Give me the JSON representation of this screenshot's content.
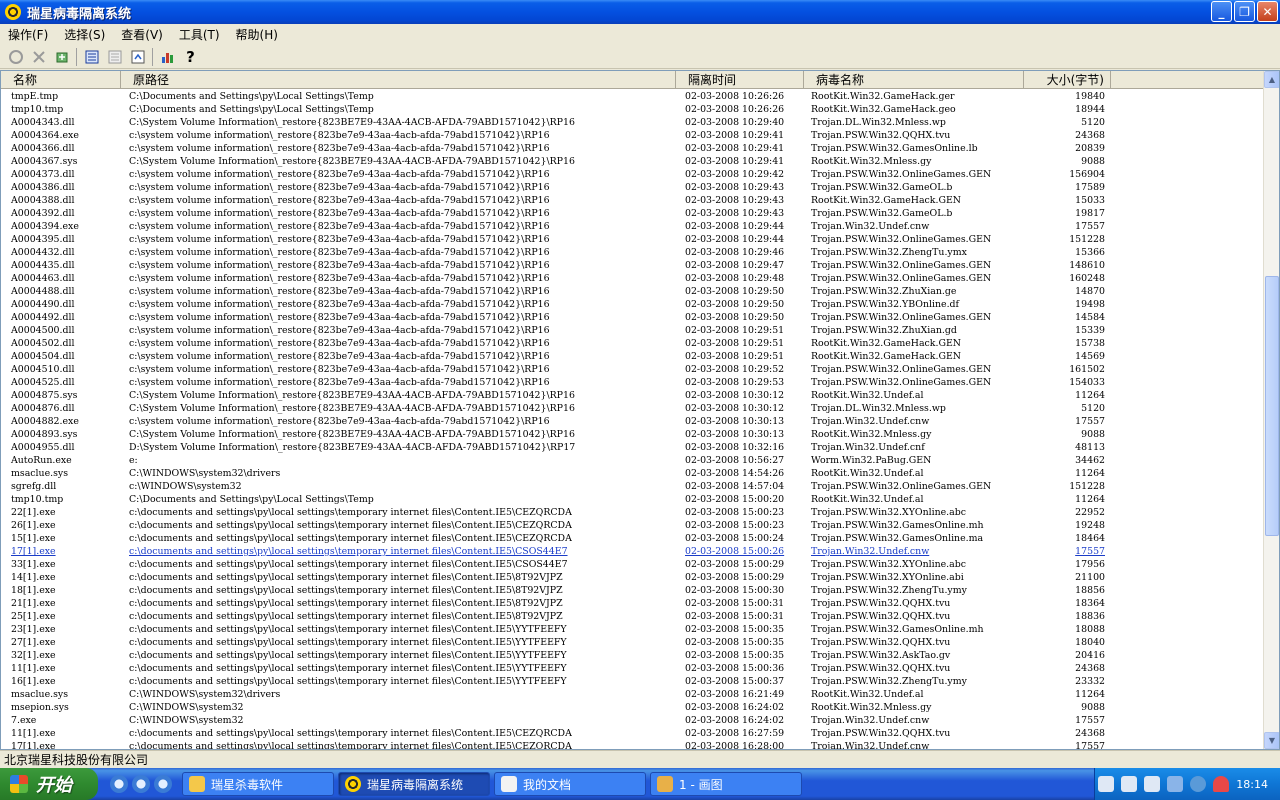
{
  "window": {
    "title": "瑞星病毒隔离系统",
    "buttons": [
      "_",
      "❐",
      "✕"
    ]
  },
  "menu": [
    "操作(F)",
    "选择(S)",
    "查看(V)",
    "工具(T)",
    "帮助(H)"
  ],
  "columns": [
    "名称",
    "原路径",
    "隔离时间",
    "病毒名称",
    "大小(字节)"
  ],
  "rows": [
    [
      "tmpE.tmp",
      "C:\\Documents and Settings\\py\\Local Settings\\Temp",
      "02-03-2008 10:26:26",
      "RootKit.Win32.GameHack.ger",
      "19840"
    ],
    [
      "tmp10.tmp",
      "C:\\Documents and Settings\\py\\Local Settings\\Temp",
      "02-03-2008 10:26:26",
      "RootKit.Win32.GameHack.geo",
      "18944"
    ],
    [
      "A0004343.dll",
      "C:\\System Volume Information\\_restore{823BE7E9-43AA-4ACB-AFDA-79ABD1571042}\\RP16",
      "02-03-2008 10:29:40",
      "Trojan.DL.Win32.Mnless.wp",
      "5120"
    ],
    [
      "A0004364.exe",
      "c:\\system volume information\\_restore{823be7e9-43aa-4acb-afda-79abd1571042}\\RP16",
      "02-03-2008 10:29:41",
      "Trojan.PSW.Win32.QQHX.tvu",
      "24368"
    ],
    [
      "A0004366.dll",
      "c:\\system volume information\\_restore{823be7e9-43aa-4acb-afda-79abd1571042}\\RP16",
      "02-03-2008 10:29:41",
      "Trojan.PSW.Win32.GamesOnline.lb",
      "20839"
    ],
    [
      "A0004367.sys",
      "C:\\System Volume Information\\_restore{823BE7E9-43AA-4ACB-AFDA-79ABD1571042}\\RP16",
      "02-03-2008 10:29:41",
      "RootKit.Win32.Mnless.gy",
      "9088"
    ],
    [
      "A0004373.dll",
      "c:\\system volume information\\_restore{823be7e9-43aa-4acb-afda-79abd1571042}\\RP16",
      "02-03-2008 10:29:42",
      "Trojan.PSW.Win32.OnlineGames.GEN",
      "156904"
    ],
    [
      "A0004386.dll",
      "c:\\system volume information\\_restore{823be7e9-43aa-4acb-afda-79abd1571042}\\RP16",
      "02-03-2008 10:29:43",
      "Trojan.PSW.Win32.GameOL.b",
      "17589"
    ],
    [
      "A0004388.dll",
      "c:\\system volume information\\_restore{823be7e9-43aa-4acb-afda-79abd1571042}\\RP16",
      "02-03-2008 10:29:43",
      "RootKit.Win32.GameHack.GEN",
      "15033"
    ],
    [
      "A0004392.dll",
      "c:\\system volume information\\_restore{823be7e9-43aa-4acb-afda-79abd1571042}\\RP16",
      "02-03-2008 10:29:43",
      "Trojan.PSW.Win32.GameOL.b",
      "19817"
    ],
    [
      "A0004394.exe",
      "c:\\system volume information\\_restore{823be7e9-43aa-4acb-afda-79abd1571042}\\RP16",
      "02-03-2008 10:29:44",
      "Trojan.Win32.Undef.cnw",
      "17557"
    ],
    [
      "A0004395.dll",
      "c:\\system volume information\\_restore{823be7e9-43aa-4acb-afda-79abd1571042}\\RP16",
      "02-03-2008 10:29:44",
      "Trojan.PSW.Win32.OnlineGames.GEN",
      "151228"
    ],
    [
      "A0004432.dll",
      "c:\\system volume information\\_restore{823be7e9-43aa-4acb-afda-79abd1571042}\\RP16",
      "02-03-2008 10:29:46",
      "Trojan.PSW.Win32.ZhengTu.ymx",
      "15366"
    ],
    [
      "A0004435.dll",
      "c:\\system volume information\\_restore{823be7e9-43aa-4acb-afda-79abd1571042}\\RP16",
      "02-03-2008 10:29:47",
      "Trojan.PSW.Win32.OnlineGames.GEN",
      "148610"
    ],
    [
      "A0004463.dll",
      "c:\\system volume information\\_restore{823be7e9-43aa-4acb-afda-79abd1571042}\\RP16",
      "02-03-2008 10:29:48",
      "Trojan.PSW.Win32.OnlineGames.GEN",
      "160248"
    ],
    [
      "A0004488.dll",
      "c:\\system volume information\\_restore{823be7e9-43aa-4acb-afda-79abd1571042}\\RP16",
      "02-03-2008 10:29:50",
      "Trojan.PSW.Win32.ZhuXian.ge",
      "14870"
    ],
    [
      "A0004490.dll",
      "c:\\system volume information\\_restore{823be7e9-43aa-4acb-afda-79abd1571042}\\RP16",
      "02-03-2008 10:29:50",
      "Trojan.PSW.Win32.YBOnline.df",
      "19498"
    ],
    [
      "A0004492.dll",
      "c:\\system volume information\\_restore{823be7e9-43aa-4acb-afda-79abd1571042}\\RP16",
      "02-03-2008 10:29:50",
      "Trojan.PSW.Win32.OnlineGames.GEN",
      "14584"
    ],
    [
      "A0004500.dll",
      "c:\\system volume information\\_restore{823be7e9-43aa-4acb-afda-79abd1571042}\\RP16",
      "02-03-2008 10:29:51",
      "Trojan.PSW.Win32.ZhuXian.gd",
      "15339"
    ],
    [
      "A0004502.dll",
      "c:\\system volume information\\_restore{823be7e9-43aa-4acb-afda-79abd1571042}\\RP16",
      "02-03-2008 10:29:51",
      "RootKit.Win32.GameHack.GEN",
      "15738"
    ],
    [
      "A0004504.dll",
      "c:\\system volume information\\_restore{823be7e9-43aa-4acb-afda-79abd1571042}\\RP16",
      "02-03-2008 10:29:51",
      "RootKit.Win32.GameHack.GEN",
      "14569"
    ],
    [
      "A0004510.dll",
      "c:\\system volume information\\_restore{823be7e9-43aa-4acb-afda-79abd1571042}\\RP16",
      "02-03-2008 10:29:52",
      "Trojan.PSW.Win32.OnlineGames.GEN",
      "161502"
    ],
    [
      "A0004525.dll",
      "c:\\system volume information\\_restore{823be7e9-43aa-4acb-afda-79abd1571042}\\RP16",
      "02-03-2008 10:29:53",
      "Trojan.PSW.Win32.OnlineGames.GEN",
      "154033"
    ],
    [
      "A0004875.sys",
      "C:\\System Volume Information\\_restore{823BE7E9-43AA-4ACB-AFDA-79ABD1571042}\\RP16",
      "02-03-2008 10:30:12",
      "RootKit.Win32.Undef.al",
      "11264"
    ],
    [
      "A0004876.dll",
      "C:\\System Volume Information\\_restore{823BE7E9-43AA-4ACB-AFDA-79ABD1571042}\\RP16",
      "02-03-2008 10:30:12",
      "Trojan.DL.Win32.Mnless.wp",
      "5120"
    ],
    [
      "A0004882.exe",
      "c:\\system volume information\\_restore{823be7e9-43aa-4acb-afda-79abd1571042}\\RP16",
      "02-03-2008 10:30:13",
      "Trojan.Win32.Undef.cnw",
      "17557"
    ],
    [
      "A0004893.sys",
      "C:\\System Volume Information\\_restore{823BE7E9-43AA-4ACB-AFDA-79ABD1571042}\\RP16",
      "02-03-2008 10:30:13",
      "RootKit.Win32.Mnless.gy",
      "9088"
    ],
    [
      "A0004955.dll",
      "D:\\System Volume Information\\_restore{823BE7E9-43AA-4ACB-AFDA-79ABD1571042}\\RP17",
      "02-03-2008 10:32:16",
      "Trojan.Win32.Undef.cnf",
      "48113"
    ],
    [
      "AutoRun.exe",
      "e:",
      "02-03-2008 10:56:27",
      "Worm.Win32.PaBug.GEN",
      "34462"
    ],
    [
      "msaclue.sys",
      "C:\\WINDOWS\\system32\\drivers",
      "02-03-2008 14:54:26",
      "RootKit.Win32.Undef.al",
      "11264"
    ],
    [
      "sgrefg.dll",
      "c:\\WINDOWS\\system32",
      "02-03-2008 14:57:04",
      "Trojan.PSW.Win32.OnlineGames.GEN",
      "151228"
    ],
    [
      "tmp10.tmp",
      "C:\\Documents and Settings\\py\\Local Settings\\Temp",
      "02-03-2008 15:00:20",
      "RootKit.Win32.Undef.al",
      "11264"
    ],
    [
      "22[1].exe",
      "c:\\documents and settings\\py\\local settings\\temporary internet files\\Content.IE5\\CEZQRCDA",
      "02-03-2008 15:00:23",
      "Trojan.PSW.Win32.XYOnline.abc",
      "22952"
    ],
    [
      "26[1].exe",
      "c:\\documents and settings\\py\\local settings\\temporary internet files\\Content.IE5\\CEZQRCDA",
      "02-03-2008 15:00:23",
      "Trojan.PSW.Win32.GamesOnline.mh",
      "19248"
    ],
    [
      "15[1].exe",
      "c:\\documents and settings\\py\\local settings\\temporary internet files\\Content.IE5\\CEZQRCDA",
      "02-03-2008 15:00:24",
      "Trojan.PSW.Win32.GamesOnline.ma",
      "18464"
    ],
    [
      "17[1].exe",
      "c:\\documents and settings\\py\\local settings\\temporary internet files\\Content.IE5\\CSOS44E7",
      "02-03-2008 15:00:26",
      "Trojan.Win32.Undef.cnw",
      "17557"
    ],
    [
      "33[1].exe",
      "c:\\documents and settings\\py\\local settings\\temporary internet files\\Content.IE5\\CSOS44E7",
      "02-03-2008 15:00:29",
      "Trojan.PSW.Win32.XYOnline.abc",
      "17956"
    ],
    [
      "14[1].exe",
      "c:\\documents and settings\\py\\local settings\\temporary internet files\\Content.IE5\\8T92VJPZ",
      "02-03-2008 15:00:29",
      "Trojan.PSW.Win32.XYOnline.abi",
      "21100"
    ],
    [
      "18[1].exe",
      "c:\\documents and settings\\py\\local settings\\temporary internet files\\Content.IE5\\8T92VJPZ",
      "02-03-2008 15:00:30",
      "Trojan.PSW.Win32.ZhengTu.ymy",
      "18856"
    ],
    [
      "21[1].exe",
      "c:\\documents and settings\\py\\local settings\\temporary internet files\\Content.IE5\\8T92VJPZ",
      "02-03-2008 15:00:31",
      "Trojan.PSW.Win32.QQHX.tvu",
      "18364"
    ],
    [
      "25[1].exe",
      "c:\\documents and settings\\py\\local settings\\temporary internet files\\Content.IE5\\8T92VJPZ",
      "02-03-2008 15:00:31",
      "Trojan.PSW.Win32.QQHX.tvu",
      "18836"
    ],
    [
      "23[1].exe",
      "c:\\documents and settings\\py\\local settings\\temporary internet files\\Content.IE5\\YYTFEEFY",
      "02-03-2008 15:00:35",
      "Trojan.PSW.Win32.GamesOnline.mh",
      "18088"
    ],
    [
      "27[1].exe",
      "c:\\documents and settings\\py\\local settings\\temporary internet files\\Content.IE5\\YYTFEEFY",
      "02-03-2008 15:00:35",
      "Trojan.PSW.Win32.QQHX.tvu",
      "18040"
    ],
    [
      "32[1].exe",
      "c:\\documents and settings\\py\\local settings\\temporary internet files\\Content.IE5\\YYTFEEFY",
      "02-03-2008 15:00:35",
      "Trojan.PSW.Win32.AskTao.gv",
      "20416"
    ],
    [
      "11[1].exe",
      "c:\\documents and settings\\py\\local settings\\temporary internet files\\Content.IE5\\YYTFEEFY",
      "02-03-2008 15:00:36",
      "Trojan.PSW.Win32.QQHX.tvu",
      "24368"
    ],
    [
      "16[1].exe",
      "c:\\documents and settings\\py\\local settings\\temporary internet files\\Content.IE5\\YYTFEEFY",
      "02-03-2008 15:00:37",
      "Trojan.PSW.Win32.ZhengTu.ymy",
      "23332"
    ],
    [
      "msaclue.sys",
      "C:\\WINDOWS\\system32\\drivers",
      "02-03-2008 16:21:49",
      "RootKit.Win32.Undef.al",
      "11264"
    ],
    [
      "msepion.sys",
      "C:\\WINDOWS\\system32",
      "02-03-2008 16:24:02",
      "RootKit.Win32.Mnless.gy",
      "9088"
    ],
    [
      "7.exe",
      "C:\\WINDOWS\\system32",
      "02-03-2008 16:24:02",
      "Trojan.Win32.Undef.cnw",
      "17557"
    ],
    [
      "11[1].exe",
      "c:\\documents and settings\\py\\local settings\\temporary internet files\\Content.IE5\\CEZQRCDA",
      "02-03-2008 16:27:59",
      "Trojan.PSW.Win32.QQHX.tvu",
      "24368"
    ],
    [
      "17[1].exe",
      "c:\\documents and settings\\py\\local settings\\temporary internet files\\Content.IE5\\CEZQRCDA",
      "02-03-2008 16:28:00",
      "Trojan.Win32.Undef.cnw",
      "17557"
    ]
  ],
  "highlighted_row": 35,
  "status": "北京瑞星科技股份有限公司",
  "taskbar": {
    "start": "开始",
    "tasks": [
      "瑞星杀毒软件",
      "瑞星病毒隔离系统",
      "我的文档",
      "1 - 画图"
    ],
    "active_task": 1,
    "clock": "18:14"
  }
}
